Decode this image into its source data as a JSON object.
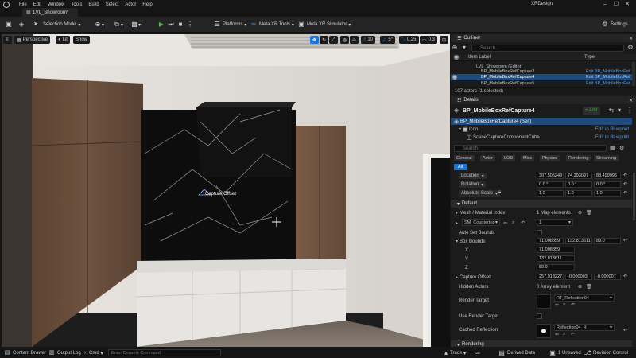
{
  "menu": [
    "File",
    "Edit",
    "Window",
    "Tools",
    "Build",
    "Select",
    "Actor",
    "Help"
  ],
  "app_title": "XRDesign",
  "tab": "LVL_Showroom*",
  "toolbar": {
    "selection_mode": "Selection Mode",
    "platforms": "Platforms",
    "meta_xr_tools": "Meta XR Tools",
    "meta_xr_simulator": "Meta XR Simulator",
    "settings": "Settings"
  },
  "viewport": {
    "perspective": "Perspective",
    "lit": "Lit",
    "show": "Show",
    "grid_snap": "10",
    "rot_snap": "5°",
    "scale_snap": "0.25",
    "cam_speed": "0.3",
    "capture_label": "Capture Offset"
  },
  "outliner": {
    "title": "Outliner",
    "search_placeholder": "Search...",
    "col_label": "Item Label",
    "col_type": "Type",
    "rows": [
      {
        "label": "LVL_Showroom (Editor)",
        "type": ""
      },
      {
        "label": "BP_MobileBoxRefCapture3",
        "type": "Edit BP_MobileBoxRef"
      },
      {
        "label": "BP_MobileBoxRefCapture4",
        "type": "Edit BP_MobileBoxRef"
      },
      {
        "label": "BP_MobileBoxRefCapture5",
        "type": "Edit BP_MobileBoxRef"
      }
    ],
    "footer": "107 actors (1 selected)"
  },
  "details": {
    "title": "Details",
    "actor_name": "BP_MobileBoxRefCapture4",
    "add_label": "+ Add",
    "components": [
      {
        "label": "BP_MobileBoxRefCapture4 (Self)",
        "link": ""
      },
      {
        "label": "Icon",
        "link": "Edit in Blueprint"
      },
      {
        "label": "SceneCaptureComponentCube",
        "link": "Edit in Blueprint"
      }
    ],
    "search_placeholder": "Search",
    "filter_tabs": [
      "General",
      "Actor",
      "LOD",
      "Misc",
      "Physics",
      "Rendering",
      "Streaming"
    ],
    "all_tab": "All",
    "transform": [
      {
        "label": "Location",
        "x": "307.505249",
        "y": "74.293097",
        "z": "88.499996"
      },
      {
        "label": "Rotation",
        "x": "0.0 °",
        "y": "0.0 °",
        "z": "0.0 °"
      },
      {
        "label": "Absolute Scale",
        "x": "1.0",
        "y": "1.0",
        "z": "1.0"
      }
    ],
    "default_section": "Default",
    "mesh_material_index": {
      "label": "Mesh / Material Index",
      "value": "1 Map elements"
    },
    "mesh_key": "SM_Countertop",
    "mesh_value": "1",
    "auto_set_bounds": "Auto Set Bounds",
    "box_bounds": {
      "label": "Box Bounds",
      "x": "71.008859",
      "y": "132.813611",
      "z": "89.0"
    },
    "box_x": {
      "label": "X",
      "value": "71.008859"
    },
    "box_y": {
      "label": "Y",
      "value": "132.813611"
    },
    "box_z": {
      "label": "Z",
      "value": "89.0"
    },
    "capture_offset": {
      "label": "Capture Offset",
      "x": "257.913227",
      "y": "-0.000003",
      "z": "-0.000007"
    },
    "hidden_actors": {
      "label": "Hidden Actors",
      "value": "0 Array element"
    },
    "render_target": {
      "label": "Render Target",
      "value": "RT_Reflection04"
    },
    "use_render_target": "Use Render Target",
    "cached_reflection": {
      "label": "Cached Reflection",
      "value": "Reflection04_R"
    },
    "rendering_section": "Rendering"
  },
  "statusbar": {
    "content_drawer": "Content Drawer",
    "output_log": "Output Log",
    "cmd": "Cmd",
    "console_placeholder": "Enter Console Command",
    "trace": "Trace",
    "derived_data": "Derived Data",
    "unsaved": "1 Unsaved",
    "revision_control": "Revision Control"
  },
  "colors": {
    "accent": "#1a76d2",
    "selected_row": "#1f4a7a",
    "add_green": "#3a3"
  }
}
